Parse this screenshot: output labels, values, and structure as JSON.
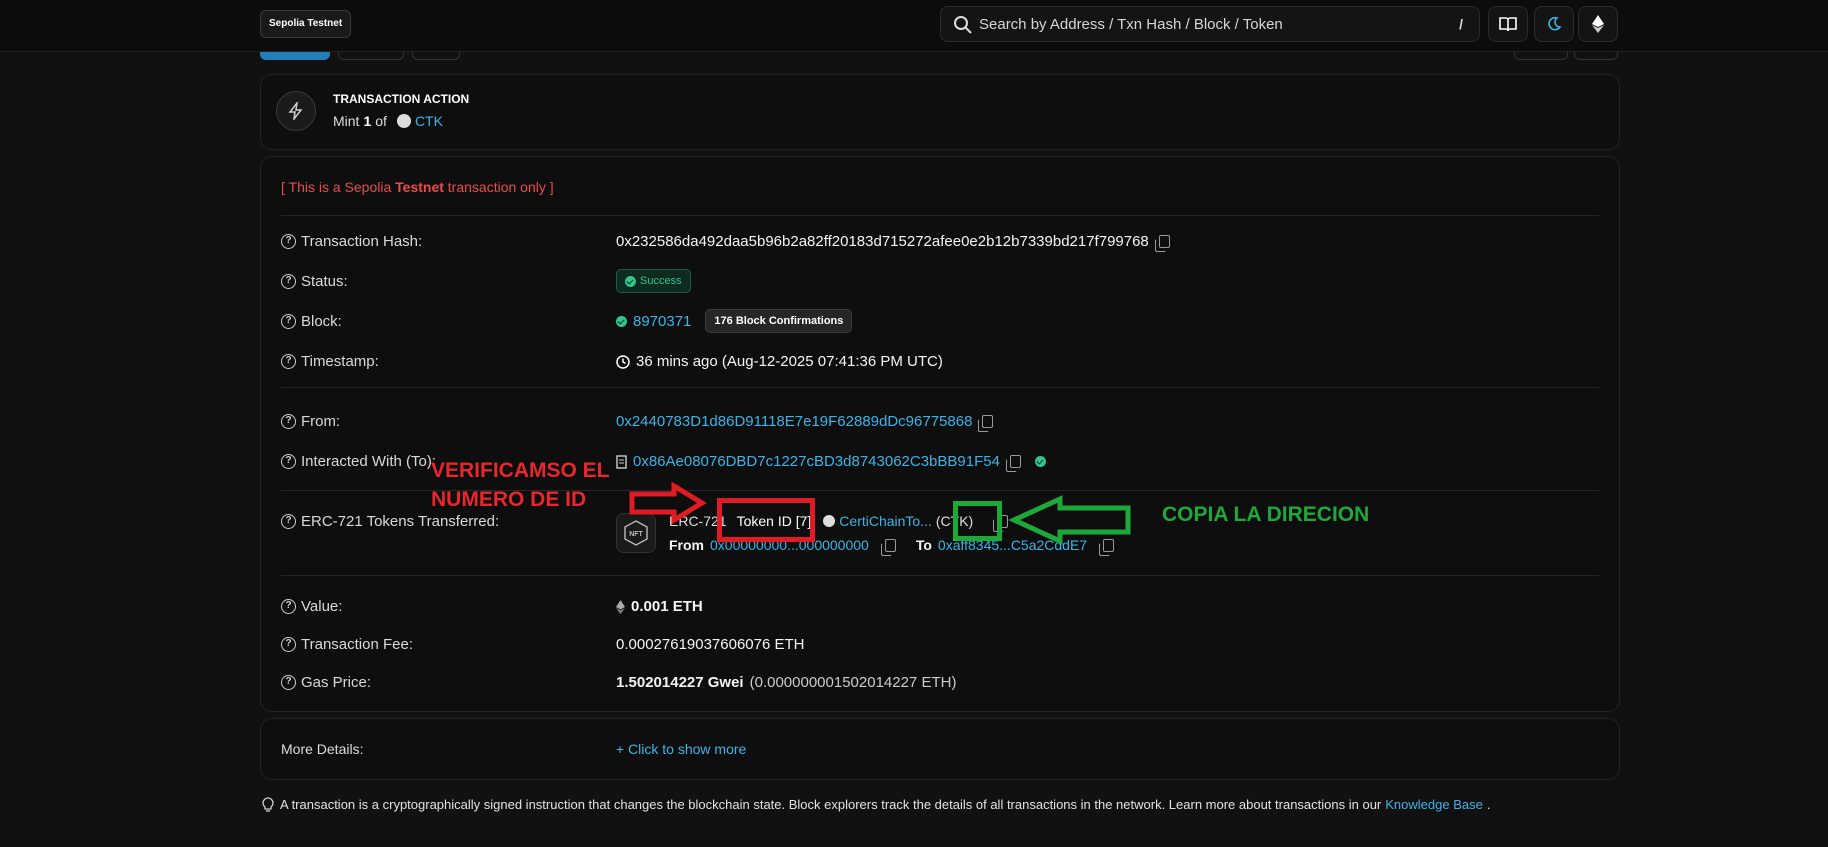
{
  "topbar": {
    "network_badge": "Sepolia Testnet",
    "search_placeholder": "Search by Address / Txn Hash / Block / Token",
    "search_shortcut": "/"
  },
  "action": {
    "heading": "TRANSACTION ACTION",
    "prefix": "Mint",
    "amount": "1",
    "of": "of",
    "token": "CTK"
  },
  "notice": {
    "pre": "[ This is a Sepolia ",
    "strong": "Testnet",
    "post": " transaction only ]"
  },
  "details": {
    "hash_label": "Transaction Hash:",
    "hash_value": "0x232586da492daa5b96b2a82ff20183d715272afee0e2b12b7339bd217f799768",
    "status_label": "Status:",
    "status_value": "Success",
    "block_label": "Block:",
    "block_value": "8970371",
    "block_confirmations": "176 Block Confirmations",
    "timestamp_label": "Timestamp:",
    "timestamp_value": "36 mins ago (Aug-12-2025 07:41:36 PM UTC)",
    "from_label": "From:",
    "from_value": "0x2440783D1d86D91118E7e19F62889dDc96775868",
    "to_label": "Interacted With (To):",
    "to_value": "0x86Ae08076DBD7c1227cBD3d8743062C3bBB91F54",
    "erc_label": "ERC-721 Tokens Transferred:",
    "erc_prefix": "ERC-721",
    "token_id": "Token ID [7]",
    "token_name": "CertiChainTo...",
    "token_symbol": "(CTK)",
    "erc_from_label": "From",
    "erc_from_value": "0x00000000...000000000",
    "erc_to_label": "To",
    "erc_to_value": "0xaff8345...C5a2CddE7",
    "nft_badge": "NFT",
    "value_label": "Value:",
    "value_value": "0.001 ETH",
    "fee_label": "Transaction Fee:",
    "fee_value": "0.00027619037606076 ETH",
    "gas_label": "Gas Price:",
    "gas_gwei": "1.502014227 Gwei",
    "gas_eth": "(0.000000001502014227 ETH)"
  },
  "more": {
    "label": "More Details:",
    "action": "+ Click to show more"
  },
  "footer": {
    "text": "A transaction is a cryptographically signed instruction that changes the blockchain state. Block explorers track the details of all transactions in the network. Learn more about transactions in our",
    "link": "Knowledge Base",
    "end": "."
  },
  "annotations": {
    "red_line1": "VERIFICAMSO EL",
    "red_line2": "NUMERO DE ID",
    "green": "COPIA LA DIRECION"
  },
  "colors": {
    "background": "#111111",
    "link": "#3cb4e8",
    "success": "#2fc78e",
    "notice": "#e84c4c",
    "annotation_red": "#e01b23",
    "annotation_green": "#1fa83a"
  }
}
